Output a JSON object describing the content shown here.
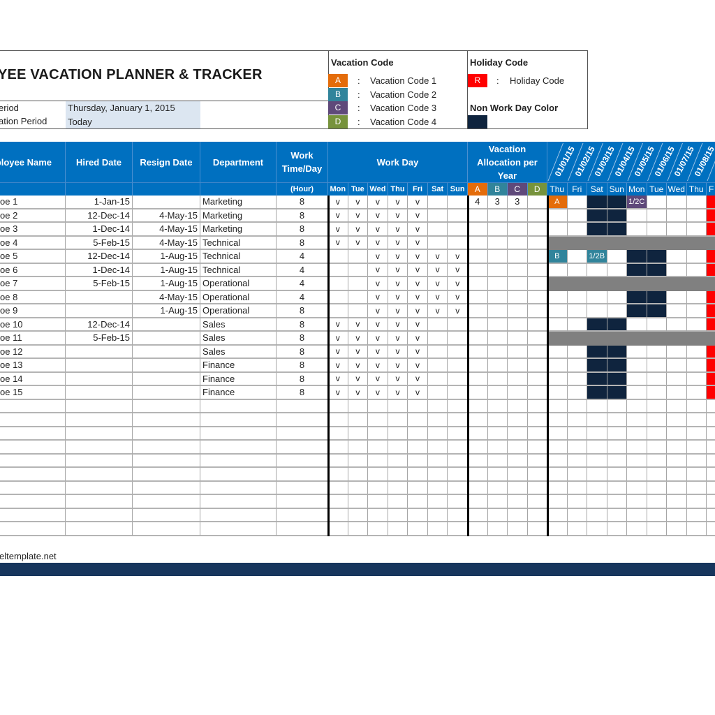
{
  "title": "YEE VACATION PLANNER & TRACKER",
  "period": {
    "start_label": "eriod",
    "start_value": "Thursday, January 1, 2015",
    "end_label": "ation Period",
    "end_value": "Today"
  },
  "vacation_legend": {
    "heading": "Vacation Code",
    "sep": ":",
    "items": [
      {
        "code": "A",
        "label": "Vacation Code 1",
        "color": "#e46c0a"
      },
      {
        "code": "B",
        "label": "Vacation Code 2",
        "color": "#31849b"
      },
      {
        "code": "C",
        "label": "Vacation Code 3",
        "color": "#5f497a"
      },
      {
        "code": "D",
        "label": "Vacation Code 4",
        "color": "#77933c"
      }
    ]
  },
  "holiday_legend": {
    "heading": "Holiday Code",
    "code": "R",
    "sep": ":",
    "label": "Holiday Code",
    "color": "#ff0000",
    "nonwork_heading": "Non Work Day Color",
    "nonwork_color": "#0f243e"
  },
  "colors": {
    "header_blue": "#0070c0",
    "inactive_gray": "#808080",
    "period_value_bg": "#dce6f1",
    "footer_bar": "#17365d"
  },
  "headers": {
    "employee_name": "ployee Name",
    "hired_date": "Hired Date",
    "resign_date": "Resign Date",
    "department": "Department",
    "work_time": "Work Time/Day",
    "work_time_unit": "(Hour)",
    "work_day": "Work Day",
    "weekdays": [
      "Mon",
      "Tue",
      "Wed",
      "Thu",
      "Fri",
      "Sat",
      "Sun"
    ],
    "allocation": "Vacation Allocation per Year",
    "allocation_codes": [
      "A",
      "B",
      "C",
      "D"
    ],
    "calendar_dates": [
      "01/01/15",
      "01/02/15",
      "01/03/15",
      "01/04/15",
      "01/05/15",
      "01/06/15",
      "01/07/15",
      "01/08/15",
      ""
    ],
    "calendar_days": [
      "Thu",
      "Fri",
      "Sat",
      "Sun",
      "Mon",
      "Tue",
      "Wed",
      "Thu",
      "F"
    ]
  },
  "employees": [
    {
      "name": "oe 1",
      "hired": "1-Jan-15",
      "resign": "",
      "dept": "Marketing",
      "hours": "8",
      "workdays": [
        "v",
        "v",
        "v",
        "v",
        "v",
        "",
        ""
      ],
      "alloc": [
        "4",
        "3",
        "3",
        ""
      ],
      "inactive": false,
      "calendar": [
        "A",
        "",
        "N",
        "N",
        "1/2C",
        "",
        "",
        "",
        "R"
      ]
    },
    {
      "name": "oe 2",
      "hired": "12-Dec-14",
      "resign": "4-May-15",
      "dept": "Marketing",
      "hours": "8",
      "workdays": [
        "v",
        "v",
        "v",
        "v",
        "v",
        "",
        ""
      ],
      "alloc": [
        "",
        "",
        "",
        ""
      ],
      "inactive": false,
      "calendar": [
        "",
        "",
        "N",
        "N",
        "",
        "",
        "",
        "",
        "R"
      ]
    },
    {
      "name": "oe 3",
      "hired": "1-Dec-14",
      "resign": "4-May-15",
      "dept": "Marketing",
      "hours": "8",
      "workdays": [
        "v",
        "v",
        "v",
        "v",
        "v",
        "",
        ""
      ],
      "alloc": [
        "",
        "",
        "",
        ""
      ],
      "inactive": false,
      "calendar": [
        "",
        "",
        "N",
        "N",
        "",
        "",
        "",
        "",
        "R"
      ]
    },
    {
      "name": "oe 4",
      "hired": "5-Feb-15",
      "resign": "4-May-15",
      "dept": "Technical",
      "hours": "8",
      "workdays": [
        "v",
        "v",
        "v",
        "v",
        "v",
        "",
        ""
      ],
      "alloc": [
        "",
        "",
        "",
        ""
      ],
      "inactive": true,
      "calendar": [
        "",
        "",
        "",
        "",
        "",
        "",
        "",
        "",
        ""
      ]
    },
    {
      "name": "oe 5",
      "hired": "12-Dec-14",
      "resign": "1-Aug-15",
      "dept": "Technical",
      "hours": "4",
      "workdays": [
        "",
        "",
        "v",
        "v",
        "v",
        "v",
        "v"
      ],
      "alloc": [
        "",
        "",
        "",
        ""
      ],
      "inactive": false,
      "calendar": [
        "B",
        "",
        "1/2B",
        "",
        "N",
        "N",
        "",
        "",
        "R"
      ]
    },
    {
      "name": "oe 6",
      "hired": "1-Dec-14",
      "resign": "1-Aug-15",
      "dept": "Technical",
      "hours": "4",
      "workdays": [
        "",
        "",
        "v",
        "v",
        "v",
        "v",
        "v"
      ],
      "alloc": [
        "",
        "",
        "",
        ""
      ],
      "inactive": false,
      "calendar": [
        "",
        "",
        "",
        "",
        "N",
        "N",
        "",
        "",
        "R"
      ]
    },
    {
      "name": "oe 7",
      "hired": "5-Feb-15",
      "resign": "1-Aug-15",
      "dept": "Operational",
      "hours": "4",
      "workdays": [
        "",
        "",
        "v",
        "v",
        "v",
        "v",
        "v"
      ],
      "alloc": [
        "",
        "",
        "",
        ""
      ],
      "inactive": true,
      "calendar": [
        "",
        "",
        "",
        "",
        "",
        "",
        "",
        "",
        ""
      ]
    },
    {
      "name": "oe 8",
      "hired": "",
      "resign": "4-May-15",
      "dept": "Operational",
      "hours": "4",
      "workdays": [
        "",
        "",
        "v",
        "v",
        "v",
        "v",
        "v"
      ],
      "alloc": [
        "",
        "",
        "",
        ""
      ],
      "inactive": false,
      "calendar": [
        "",
        "",
        "",
        "",
        "N",
        "N",
        "",
        "",
        "R"
      ]
    },
    {
      "name": "oe 9",
      "hired": "",
      "resign": "1-Aug-15",
      "dept": "Operational",
      "hours": "8",
      "workdays": [
        "",
        "",
        "v",
        "v",
        "v",
        "v",
        "v"
      ],
      "alloc": [
        "",
        "",
        "",
        ""
      ],
      "inactive": false,
      "calendar": [
        "",
        "",
        "",
        "",
        "N",
        "N",
        "",
        "",
        "R"
      ]
    },
    {
      "name": "oe 10",
      "hired": "12-Dec-14",
      "resign": "",
      "dept": "Sales",
      "hours": "8",
      "workdays": [
        "v",
        "v",
        "v",
        "v",
        "v",
        "",
        ""
      ],
      "alloc": [
        "",
        "",
        "",
        ""
      ],
      "inactive": false,
      "calendar": [
        "",
        "",
        "N",
        "N",
        "",
        "",
        "",
        "",
        "R"
      ]
    },
    {
      "name": "oe 11",
      "hired": "5-Feb-15",
      "resign": "",
      "dept": "Sales",
      "hours": "8",
      "workdays": [
        "v",
        "v",
        "v",
        "v",
        "v",
        "",
        ""
      ],
      "alloc": [
        "",
        "",
        "",
        ""
      ],
      "inactive": true,
      "calendar": [
        "",
        "",
        "",
        "",
        "",
        "",
        "",
        "",
        ""
      ]
    },
    {
      "name": "oe 12",
      "hired": "",
      "resign": "",
      "dept": "Sales",
      "hours": "8",
      "workdays": [
        "v",
        "v",
        "v",
        "v",
        "v",
        "",
        ""
      ],
      "alloc": [
        "",
        "",
        "",
        ""
      ],
      "inactive": false,
      "calendar": [
        "",
        "",
        "N",
        "N",
        "",
        "",
        "",
        "",
        "R"
      ]
    },
    {
      "name": "oe 13",
      "hired": "",
      "resign": "",
      "dept": "Finance",
      "hours": "8",
      "workdays": [
        "v",
        "v",
        "v",
        "v",
        "v",
        "",
        ""
      ],
      "alloc": [
        "",
        "",
        "",
        ""
      ],
      "inactive": false,
      "calendar": [
        "",
        "",
        "N",
        "N",
        "",
        "",
        "",
        "",
        "R"
      ]
    },
    {
      "name": "oe 14",
      "hired": "",
      "resign": "",
      "dept": "Finance",
      "hours": "8",
      "workdays": [
        "v",
        "v",
        "v",
        "v",
        "v",
        "",
        ""
      ],
      "alloc": [
        "",
        "",
        "",
        ""
      ],
      "inactive": false,
      "calendar": [
        "",
        "",
        "N",
        "N",
        "",
        "",
        "",
        "",
        "R"
      ]
    },
    {
      "name": "oe 15",
      "hired": "",
      "resign": "",
      "dept": "Finance",
      "hours": "8",
      "workdays": [
        "v",
        "v",
        "v",
        "v",
        "v",
        "",
        ""
      ],
      "alloc": [
        "",
        "",
        "",
        ""
      ],
      "inactive": false,
      "calendar": [
        "",
        "",
        "N",
        "N",
        "",
        "",
        "",
        "",
        "R"
      ]
    }
  ],
  "empty_rows": 10,
  "footer": {
    "text": "eltemplate.net"
  }
}
